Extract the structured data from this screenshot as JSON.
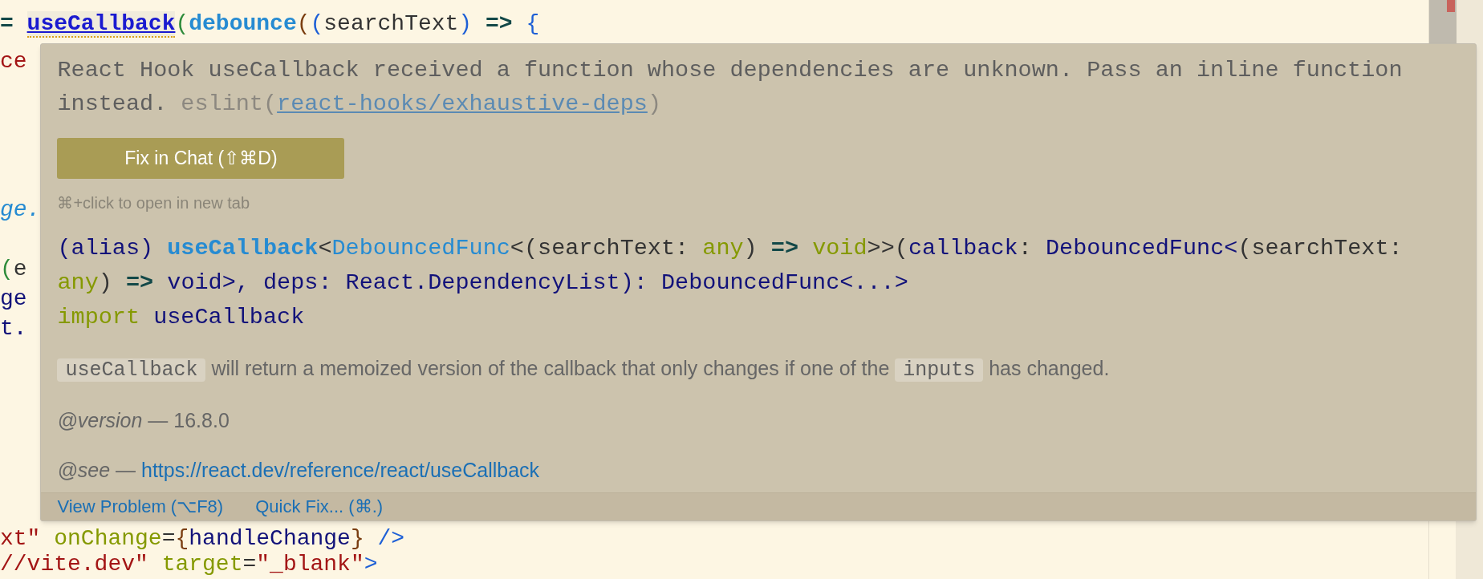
{
  "editor": {
    "top_line": [
      {
        "text": "= ",
        "kind": "op"
      },
      {
        "text": "useCallback",
        "kind": "hook",
        "squiggle": true
      },
      {
        "text": "(",
        "kind": "bracket1"
      },
      {
        "text": "debounce",
        "kind": "func"
      },
      {
        "text": "(",
        "kind": "bracket2"
      },
      {
        "text": "(",
        "kind": "bracket3"
      },
      {
        "text": "searchText",
        "kind": "plain"
      },
      {
        "text": ")",
        "kind": "bracket3"
      },
      {
        "text": " => ",
        "kind": "op"
      },
      {
        "text": "{",
        "kind": "bracket3"
      }
    ],
    "side_lines": [
      [
        {
          "text": "ce",
          "kind": "string"
        }
      ],
      [
        {
          "text": "ge.",
          "kind": "italic_func"
        }
      ],
      [
        {
          "text": "(",
          "kind": "bracket1"
        },
        {
          "text": "e",
          "kind": "plain"
        }
      ],
      [
        {
          "text": "ge",
          "kind": "ident"
        }
      ],
      [
        {
          "text": "t.",
          "kind": "ident"
        }
      ]
    ],
    "bottom_lines": [
      [
        {
          "text": "xt\"",
          "kind": "string"
        },
        {
          "text": " onChange",
          "kind": "attr"
        },
        {
          "text": "=",
          "kind": "plain"
        },
        {
          "text": "{",
          "kind": "bracket2"
        },
        {
          "text": "handleChange",
          "kind": "ident"
        },
        {
          "text": "}",
          "kind": "bracket2"
        },
        {
          "text": " />",
          "kind": "bracket3"
        }
      ],
      [
        {
          "text": "//vite.dev\"",
          "kind": "string"
        },
        {
          "text": " target",
          "kind": "attr"
        },
        {
          "text": "=",
          "kind": "plain"
        },
        {
          "text": "\"_blank\"",
          "kind": "string"
        },
        {
          "text": ">",
          "kind": "bracket3"
        }
      ]
    ]
  },
  "hover": {
    "message": [
      {
        "text": "React Hook useCallback received a function whose dependencies are unknown. Pass an inline function instead. ",
        "kind": "text"
      },
      {
        "text": "eslint(",
        "kind": "dim"
      },
      {
        "text": "react-hooks/exhaustive-deps",
        "kind": "link"
      },
      {
        "text": ")",
        "kind": "dim"
      }
    ],
    "fix_button": "Fix in Chat (⇧⌘D)",
    "hint": "⌘+click to open in new tab",
    "signature": [
      [
        {
          "text": "(alias) ",
          "kind": "ident"
        },
        {
          "text": "useCallback",
          "kind": "fn_name"
        },
        {
          "text": "<",
          "kind": "plain"
        },
        {
          "text": "DebouncedFunc",
          "kind": "type"
        },
        {
          "text": "<(searchText: ",
          "kind": "plain"
        },
        {
          "text": "any",
          "kind": "attr"
        },
        {
          "text": ") ",
          "kind": "plain"
        },
        {
          "text": "=>",
          "kind": "op"
        },
        {
          "text": " void",
          "kind": "attr"
        },
        {
          "text": ">>(",
          "kind": "plain"
        },
        {
          "text": "callback",
          "kind": "ident"
        },
        {
          "text": ": ",
          "kind": "plain"
        },
        {
          "text": "DebouncedFunc<",
          "kind": "ident"
        },
        {
          "text": "(searchText:",
          "kind": "plain"
        }
      ],
      [
        {
          "text": "any",
          "kind": "attr"
        },
        {
          "text": ") ",
          "kind": "plain"
        },
        {
          "text": "=>",
          "kind": "op"
        },
        {
          "text": " void>, deps: React.DependencyList): DebouncedFunc<...>",
          "kind": "ident"
        }
      ],
      [
        {
          "text": "import",
          "kind": "attr"
        },
        {
          "text": " useCallback",
          "kind": "ident"
        }
      ]
    ],
    "description": [
      {
        "text": "useCallback",
        "kind": "code"
      },
      {
        "text": " will return a memoized version of the callback that only changes if one of the ",
        "kind": "text"
      },
      {
        "text": "inputs",
        "kind": "code"
      },
      {
        "text": " has changed.",
        "kind": "text"
      }
    ],
    "tags": [
      {
        "label": "*@version* — 16.8.0",
        "kind": "text"
      },
      {
        "label": "*@see* —",
        "link": "https://react.dev/reference/react/useCallback",
        "kind": "link"
      }
    ],
    "actions": [
      "View Problem (⌥F8)",
      "Quick Fix... (⌘.)"
    ]
  }
}
